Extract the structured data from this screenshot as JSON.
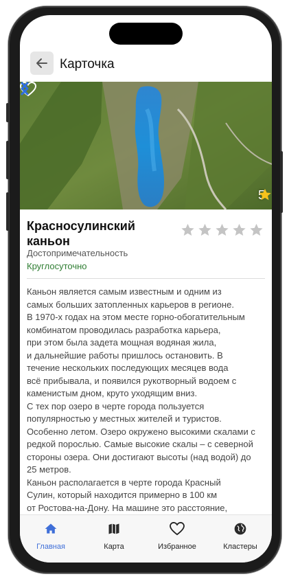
{
  "header": {
    "title": "Карточка",
    "back_icon": "arrow-left-icon"
  },
  "place": {
    "name": "Красносулинский каньон",
    "category": "Достопримечательность",
    "hours": "Круглосуточно",
    "photo_rating": "5",
    "user_stars": 0,
    "max_stars": 5
  },
  "description": [
    "Каньон является самым известным и одним из",
    "самых больших затопленных  карьеров в регионе.",
    "В 1970-х годах на этом месте горно-обогатительным",
    "комбинатом проводилась разработка карьера,",
    "при этом была задета мощная водяная жила,",
    "и дальнейшие работы пришлось остановить. В",
    "течение нескольких последующих месяцев вода",
    "всё прибывала, и появился рукотворный водоем с",
    "каменистым дном, круто уходящим вниз.",
    "С тех пор озеро в черте города пользуется",
    "популярностью у местных жителей и  туристов.",
    "Особенно летом. Озеро окружено высокими скалами с",
    "редкой порослью. Самые высокие скалы – с северной",
    "стороны озера. Они достигают высоты (над водой) до",
    "25 метров.",
    "Каньон располагается в черте города Красный",
    "Сулин, который находится примерно в 100 км",
    "от Ростова-на-Дону. На машине это расстояние,"
  ],
  "nav": [
    {
      "label": "Главная",
      "icon": "home-icon",
      "active": true
    },
    {
      "label": "Карта",
      "icon": "map-icon",
      "active": false
    },
    {
      "label": "Избранное",
      "icon": "heart-icon",
      "active": false
    },
    {
      "label": "Кластеры",
      "icon": "globe-icon",
      "active": false
    }
  ],
  "colors": {
    "accent": "#3f6fd8",
    "hours": "#2e7d32",
    "star_empty": "#c4c4c4",
    "star_filled": "#f6c21c"
  }
}
